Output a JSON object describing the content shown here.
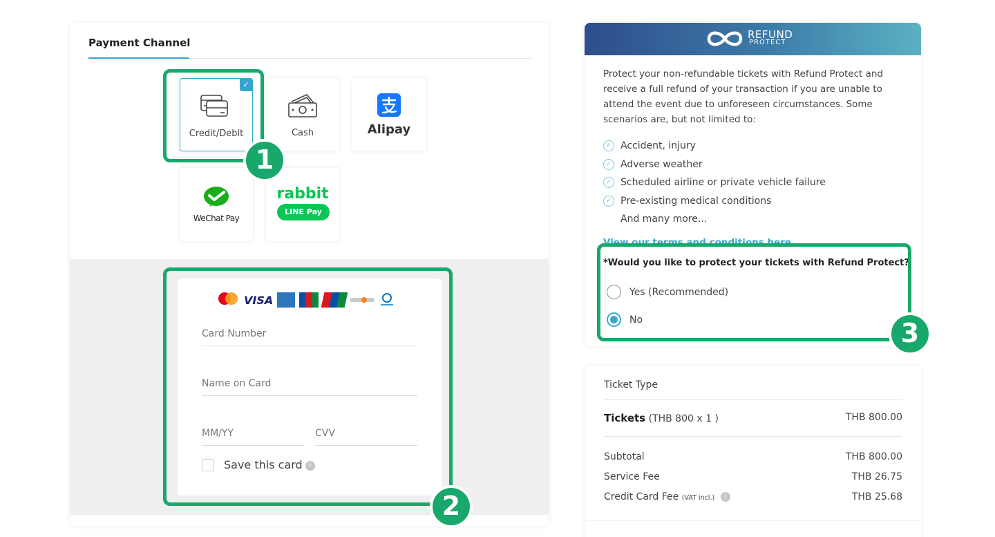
{
  "payment_channel": {
    "title": "Payment Channel",
    "options": [
      {
        "label": "Credit/Debit",
        "icon": "credit-card-icon",
        "selected": true
      },
      {
        "label": "Cash",
        "icon": "cash-icon",
        "selected": false
      },
      {
        "label": "Alipay",
        "icon": "alipay-logo",
        "selected": false
      },
      {
        "label": "WeChat Pay",
        "icon": "wechat-pay-logo",
        "selected": false
      },
      {
        "label": "rabbit",
        "sublabel": "LINE Pay",
        "icon": "rabbit-line-pay-logo",
        "selected": false
      }
    ]
  },
  "card_form": {
    "brands": [
      "VISA"
    ],
    "card_number_placeholder": "Card Number",
    "name_placeholder": "Name on Card",
    "expiry_placeholder": "MM/YY",
    "cvv_placeholder": "CVV",
    "save_label": "Save this card",
    "info_glyph": "i"
  },
  "refund_protect": {
    "logo_top": "REFUND",
    "logo_bottom": "PROTECT",
    "description": "Protect your non-refundable tickets with Refund Protect and receive a full refund of your transaction if you are unable to attend the event due to unforeseen circumstances. Some scenarios are, but not limited to:",
    "scenarios": [
      "Accident, injury",
      "Adverse weather",
      "Scheduled airline or private vehicle failure",
      "Pre-existing medical conditions"
    ],
    "more": "And many more...",
    "terms_link": "View our terms and conditions here",
    "question": "*Would you like to protect your tickets with Refund Protect?",
    "options": [
      {
        "label": "Yes (Recommended)",
        "selected": false
      },
      {
        "label": "No",
        "selected": true
      }
    ]
  },
  "summary": {
    "header": "Ticket Type",
    "tickets_label": "Tickets",
    "tickets_detail": "(THB 800 x 1 )",
    "tickets_amount": "THB 800.00",
    "subtotal_label": "Subtotal",
    "subtotal_amount": "THB 800.00",
    "service_fee_label": "Service Fee",
    "service_fee_amount": "THB 26.75",
    "cc_fee_label": "Credit Card Fee",
    "cc_fee_note": "(VAT incl.)",
    "cc_fee_amount": "THB 25.68"
  },
  "annotations": [
    "1",
    "2",
    "3"
  ],
  "colors": {
    "accent": "#37a6cf",
    "highlight": "#18a86b"
  }
}
